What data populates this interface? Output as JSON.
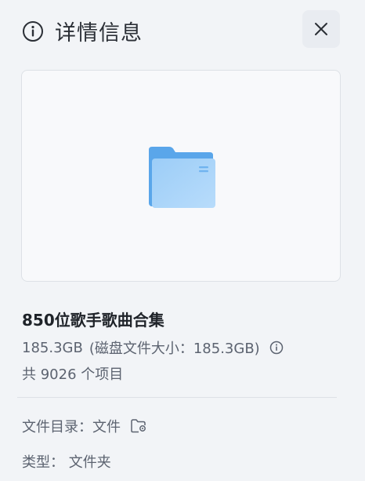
{
  "header": {
    "title": "详情信息",
    "info_icon": "info-circle-icon",
    "close_icon": "close-icon"
  },
  "preview": {
    "icon": "folder-icon",
    "folder_color": "#5aa6ea"
  },
  "item": {
    "name": "850位歌手歌曲合集",
    "size": "185.3GB",
    "disk_size_note": "(磁盘文件大小：185.3GB)",
    "count_text": "共 9026 个项目"
  },
  "details": {
    "directory_label": "文件目录：",
    "directory_value": "文件",
    "type_label": "类型：",
    "type_value": "文件夹"
  }
}
